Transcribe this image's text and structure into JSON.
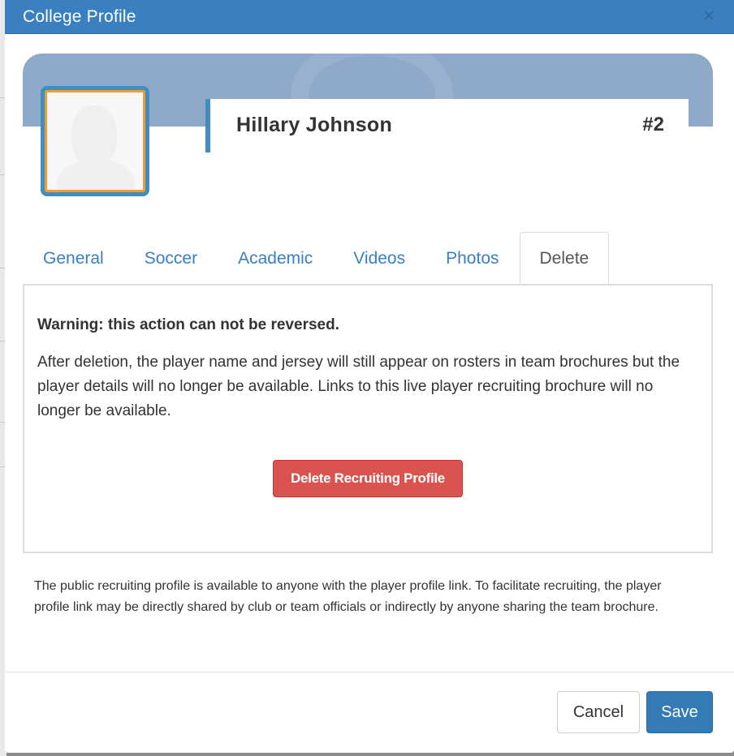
{
  "modal": {
    "title": "College Profile",
    "close_icon": "×"
  },
  "profile": {
    "name": "Hillary Johnson",
    "jersey": "#2"
  },
  "tabs": [
    {
      "label": "General",
      "active": false
    },
    {
      "label": "Soccer",
      "active": false
    },
    {
      "label": "Academic",
      "active": false
    },
    {
      "label": "Videos",
      "active": false
    },
    {
      "label": "Photos",
      "active": false
    },
    {
      "label": "Delete",
      "active": true
    }
  ],
  "delete_panel": {
    "warning": "Warning: this action can not be reversed.",
    "explanation": "After deletion, the player name and jersey will still appear on rosters in team brochures but the player details will no longer be available. Links to this live player recruiting brochure will no longer be available.",
    "delete_button": "Delete Recruiting Profile"
  },
  "footnote": "The public recruiting profile is available to anyone with the player profile link. To facilitate recruiting, the player profile link may be directly shared by club or team officials or indirectly by anyone sharing the team brochure.",
  "footer": {
    "cancel_label": "Cancel",
    "save_label": "Save"
  },
  "colors": {
    "header": "#3a80c1",
    "danger": "#d9534f",
    "primary": "#337ab7",
    "avatar_frame": "#3e8fbf",
    "avatar_border": "#f39a33"
  }
}
